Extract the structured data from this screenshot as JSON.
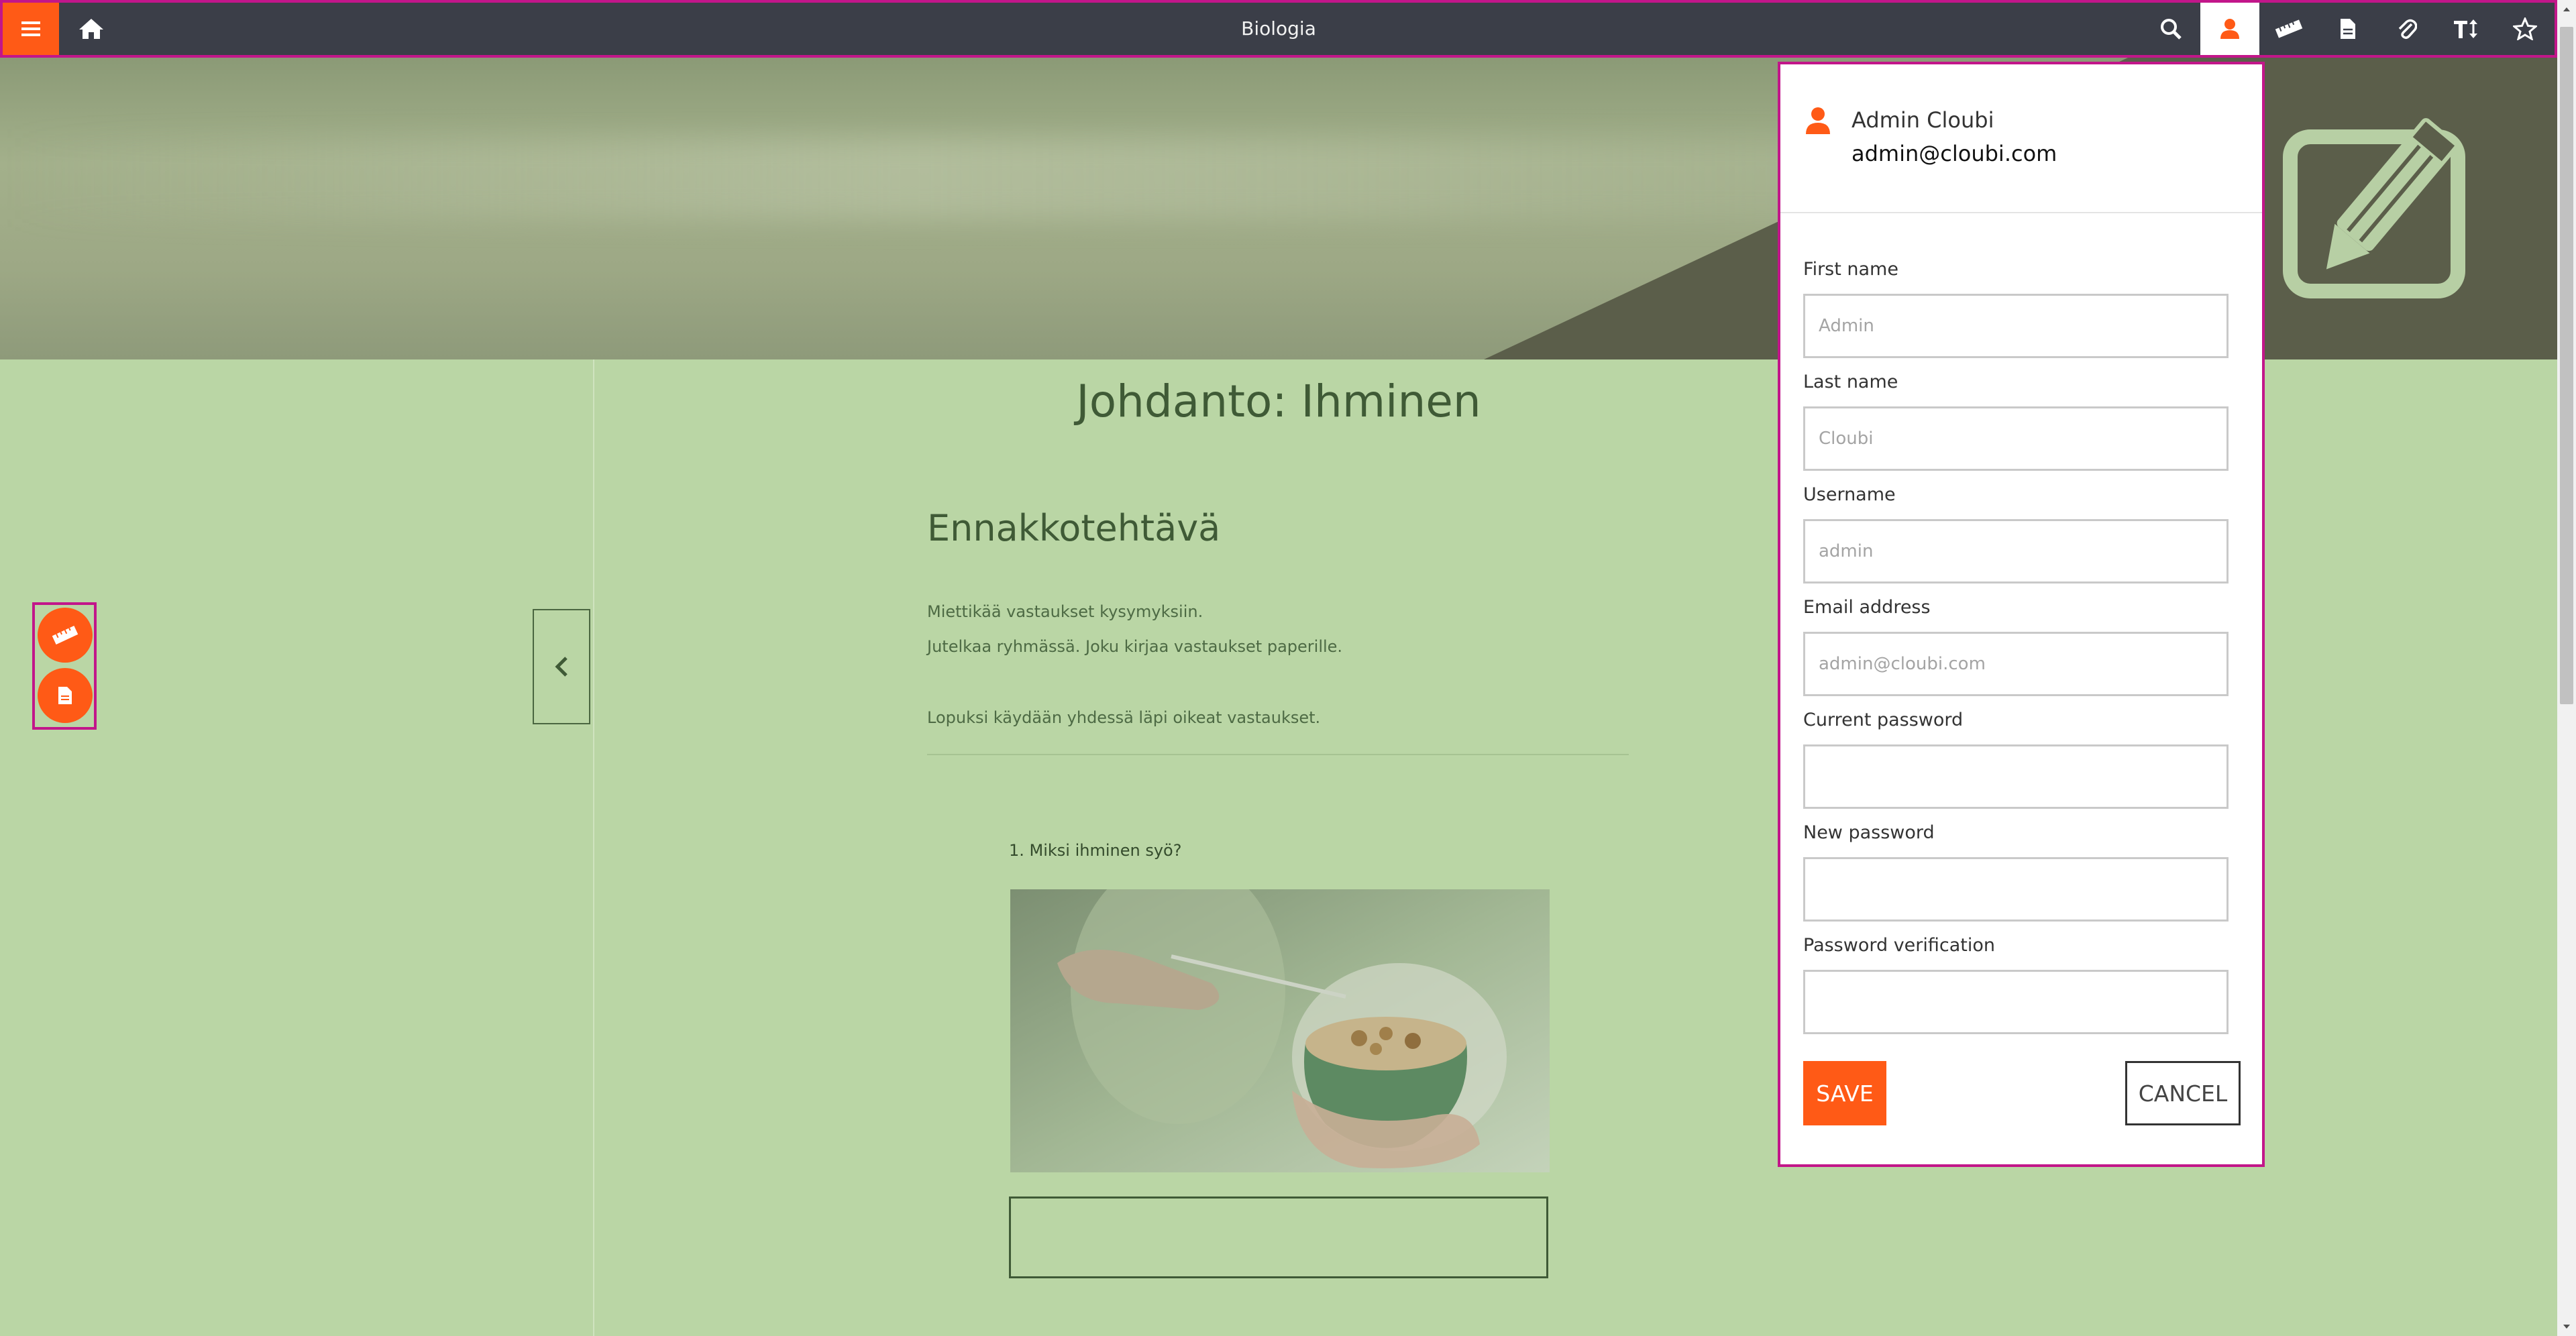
{
  "topbar": {
    "title": "Biologia",
    "icons": [
      "menu-icon",
      "home-icon",
      "search-icon",
      "user-icon",
      "ruler-icon",
      "document-icon",
      "paperclip-icon",
      "text-size-icon",
      "star-icon"
    ],
    "accent": "#ff5a16",
    "bar_color": "#3b3e48"
  },
  "main": {
    "page_title": "Johdanto: Ihminen",
    "section_heading": "Ennakkotehtävä",
    "paragraphs": [
      "Miettikää vastaukset kysymyksiin.",
      "Jutelkaa ryhmässä. Joku kirjaa vastaukset paperille.",
      "Lopuksi käydään yhdessä läpi oikeat vastaukset."
    ],
    "question": "1. Miksi ihminen syö?",
    "image_icon": "cereal-bowl-photo"
  },
  "sidetools": {
    "icons": [
      "ruler-icon",
      "document-icon"
    ]
  },
  "profile": {
    "display_name": "Admin Cloubi",
    "email": "admin@cloubi.com",
    "fields": {
      "first_name": {
        "label": "First name",
        "placeholder": "Admin"
      },
      "last_name": {
        "label": "Last name",
        "placeholder": "Cloubi"
      },
      "username": {
        "label": "Username",
        "placeholder": "admin"
      },
      "email": {
        "label": "Email address",
        "placeholder": "admin@cloubi.com"
      },
      "current_password": {
        "label": "Current password",
        "placeholder": ""
      },
      "new_password": {
        "label": "New password",
        "placeholder": ""
      },
      "password_verification": {
        "label": "Password verification",
        "placeholder": ""
      }
    },
    "save_label": "SAVE",
    "cancel_label": "CANCEL"
  }
}
